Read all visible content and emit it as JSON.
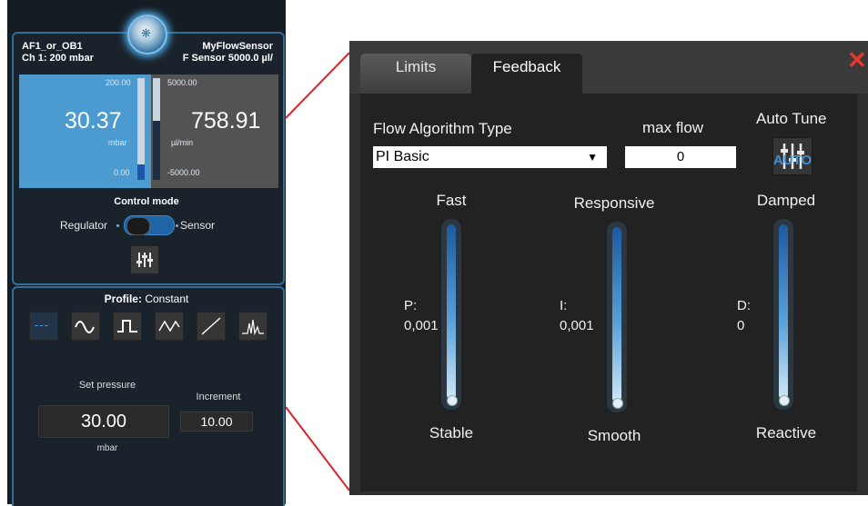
{
  "left_panel": {
    "header_left_line1": "AF1_or_OB1",
    "header_left_line2": "Ch 1: 200 mbar",
    "header_right_line1": "MyFlowSensor",
    "header_right_line2": "F Sensor 5000.0 µl/",
    "pressure": {
      "max": "200.00",
      "value": "30.37",
      "unit": "mbar",
      "min": "0.00",
      "level_fraction": 0.15
    },
    "flow": {
      "max": "5000.00",
      "value": "758.91",
      "unit": "µl/min",
      "min": "-5000.00",
      "level_fraction": 0.58
    },
    "control_mode": {
      "title": "Control mode",
      "left_label": "Regulator",
      "right_label": "Sensor",
      "selected": "Sensor"
    },
    "profile": {
      "label": "Profile:",
      "value": "Constant",
      "buttons": [
        "constant",
        "sine",
        "square",
        "triangle",
        "ramp",
        "custom"
      ],
      "constant_glyph": "---"
    },
    "set_pressure": {
      "label": "Set pressure",
      "value": "30.00",
      "unit": "mbar"
    },
    "increment": {
      "label": "Increment",
      "value": "10.00"
    }
  },
  "dialog": {
    "tabs": [
      "Limits",
      "Feedback"
    ],
    "active_tab": "Feedback",
    "close_glyph": "✕",
    "algorithm_label": "Flow Algorithm Type",
    "algorithm_value": "PI Basic",
    "maxflow_label": "max flow",
    "maxflow_value": "0",
    "autotune_label": "Auto Tune",
    "autotune_icon_text": "AUTO",
    "sliders": {
      "p": {
        "top": "Fast",
        "bottom": "Stable",
        "gain_label": "P:",
        "gain_value": "0,001",
        "level_fraction": 0.0
      },
      "i": {
        "top": "Responsive",
        "bottom": "Smooth",
        "gain_label": "I:",
        "gain_value": "0,001",
        "level_fraction": 0.0
      },
      "d": {
        "top": "Damped",
        "bottom": "Reactive",
        "gain_label": "D:",
        "gain_value": "0",
        "level_fraction": 0.0
      }
    }
  },
  "colors": {
    "accent_blue": "#4b9bd0",
    "panel_border": "#2e6f9a",
    "close_red": "#e23b2e",
    "connector_red": "#e0202a"
  }
}
